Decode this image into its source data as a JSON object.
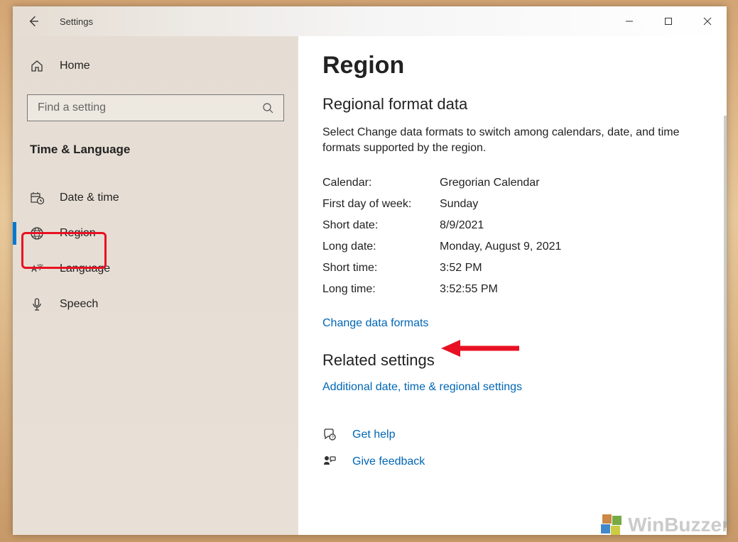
{
  "titlebar": {
    "app_name": "Settings"
  },
  "sidebar": {
    "home_label": "Home",
    "search_placeholder": "Find a setting",
    "group_title": "Time & Language",
    "items": [
      {
        "label": "Date & time",
        "icon": "calendar-clock-icon"
      },
      {
        "label": "Region",
        "icon": "globe-icon"
      },
      {
        "label": "Language",
        "icon": "language-icon"
      },
      {
        "label": "Speech",
        "icon": "microphone-icon"
      }
    ]
  },
  "main": {
    "page_title": "Region",
    "section_title": "Regional format data",
    "description": "Select Change data formats to switch among calendars, date, and time formats supported by the region.",
    "formats": [
      {
        "label": "Calendar:",
        "value": "Gregorian Calendar"
      },
      {
        "label": "First day of week:",
        "value": "Sunday"
      },
      {
        "label": "Short date:",
        "value": "8/9/2021"
      },
      {
        "label": "Long date:",
        "value": "Monday, August 9, 2021"
      },
      {
        "label": "Short time:",
        "value": "3:52 PM"
      },
      {
        "label": "Long time:",
        "value": "3:52:55 PM"
      }
    ],
    "change_formats_link": "Change data formats",
    "related_title": "Related settings",
    "related_link": "Additional date, time & regional settings",
    "get_help": "Get help",
    "give_feedback": "Give feedback"
  },
  "watermark": "WinBuzzer"
}
